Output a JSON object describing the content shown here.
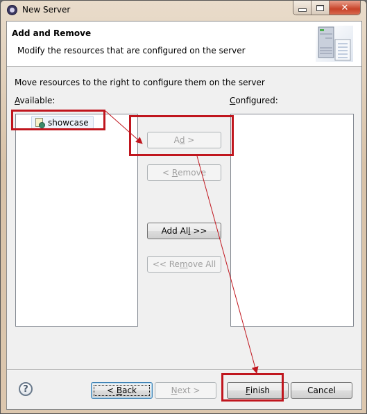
{
  "window": {
    "title": "New Server",
    "controls": {
      "minimize": "minimize",
      "maximize": "maximize",
      "close": "close"
    }
  },
  "banner": {
    "title": "Add and Remove",
    "description": "Modify the resources that are configured on the server",
    "icon": "server-wizard-icon"
  },
  "body": {
    "instruction": "Move resources to the right to configure them on the server",
    "available_label": {
      "mnemonic": "A",
      "rest": "vailable:"
    },
    "configured_label": {
      "mnemonic": "C",
      "rest": "onfigured:"
    },
    "available_items": [
      {
        "label": "showcase",
        "icon": "web-project-icon",
        "selected": true
      }
    ],
    "configured_items": []
  },
  "move_buttons": {
    "add": {
      "pre": "A",
      "mnemonic": "d",
      "post": "d >",
      "enabled": false
    },
    "remove": {
      "pre": "< ",
      "mnemonic": "R",
      "post": "emove",
      "enabled": false
    },
    "add_all": {
      "pre": "Add A",
      "mnemonic": "l",
      "post": "l >>",
      "enabled": true
    },
    "remove_all": {
      "pre": "<< Re",
      "mnemonic": "m",
      "post": "ove All",
      "enabled": false
    }
  },
  "footer": {
    "help_icon": "?",
    "back": {
      "pre": "< ",
      "mnemonic": "B",
      "post": "ack",
      "enabled": true,
      "focused": true
    },
    "next": {
      "pre": "",
      "mnemonic": "N",
      "post": "ext >",
      "enabled": false
    },
    "finish": {
      "pre": "",
      "mnemonic": "F",
      "post": "inish",
      "enabled": true
    },
    "cancel": {
      "label": "Cancel",
      "enabled": true
    }
  },
  "annotations": {
    "color": "#c0161e",
    "note": "red highlight boxes and arrows: showcase -> Add > -> Finish"
  }
}
